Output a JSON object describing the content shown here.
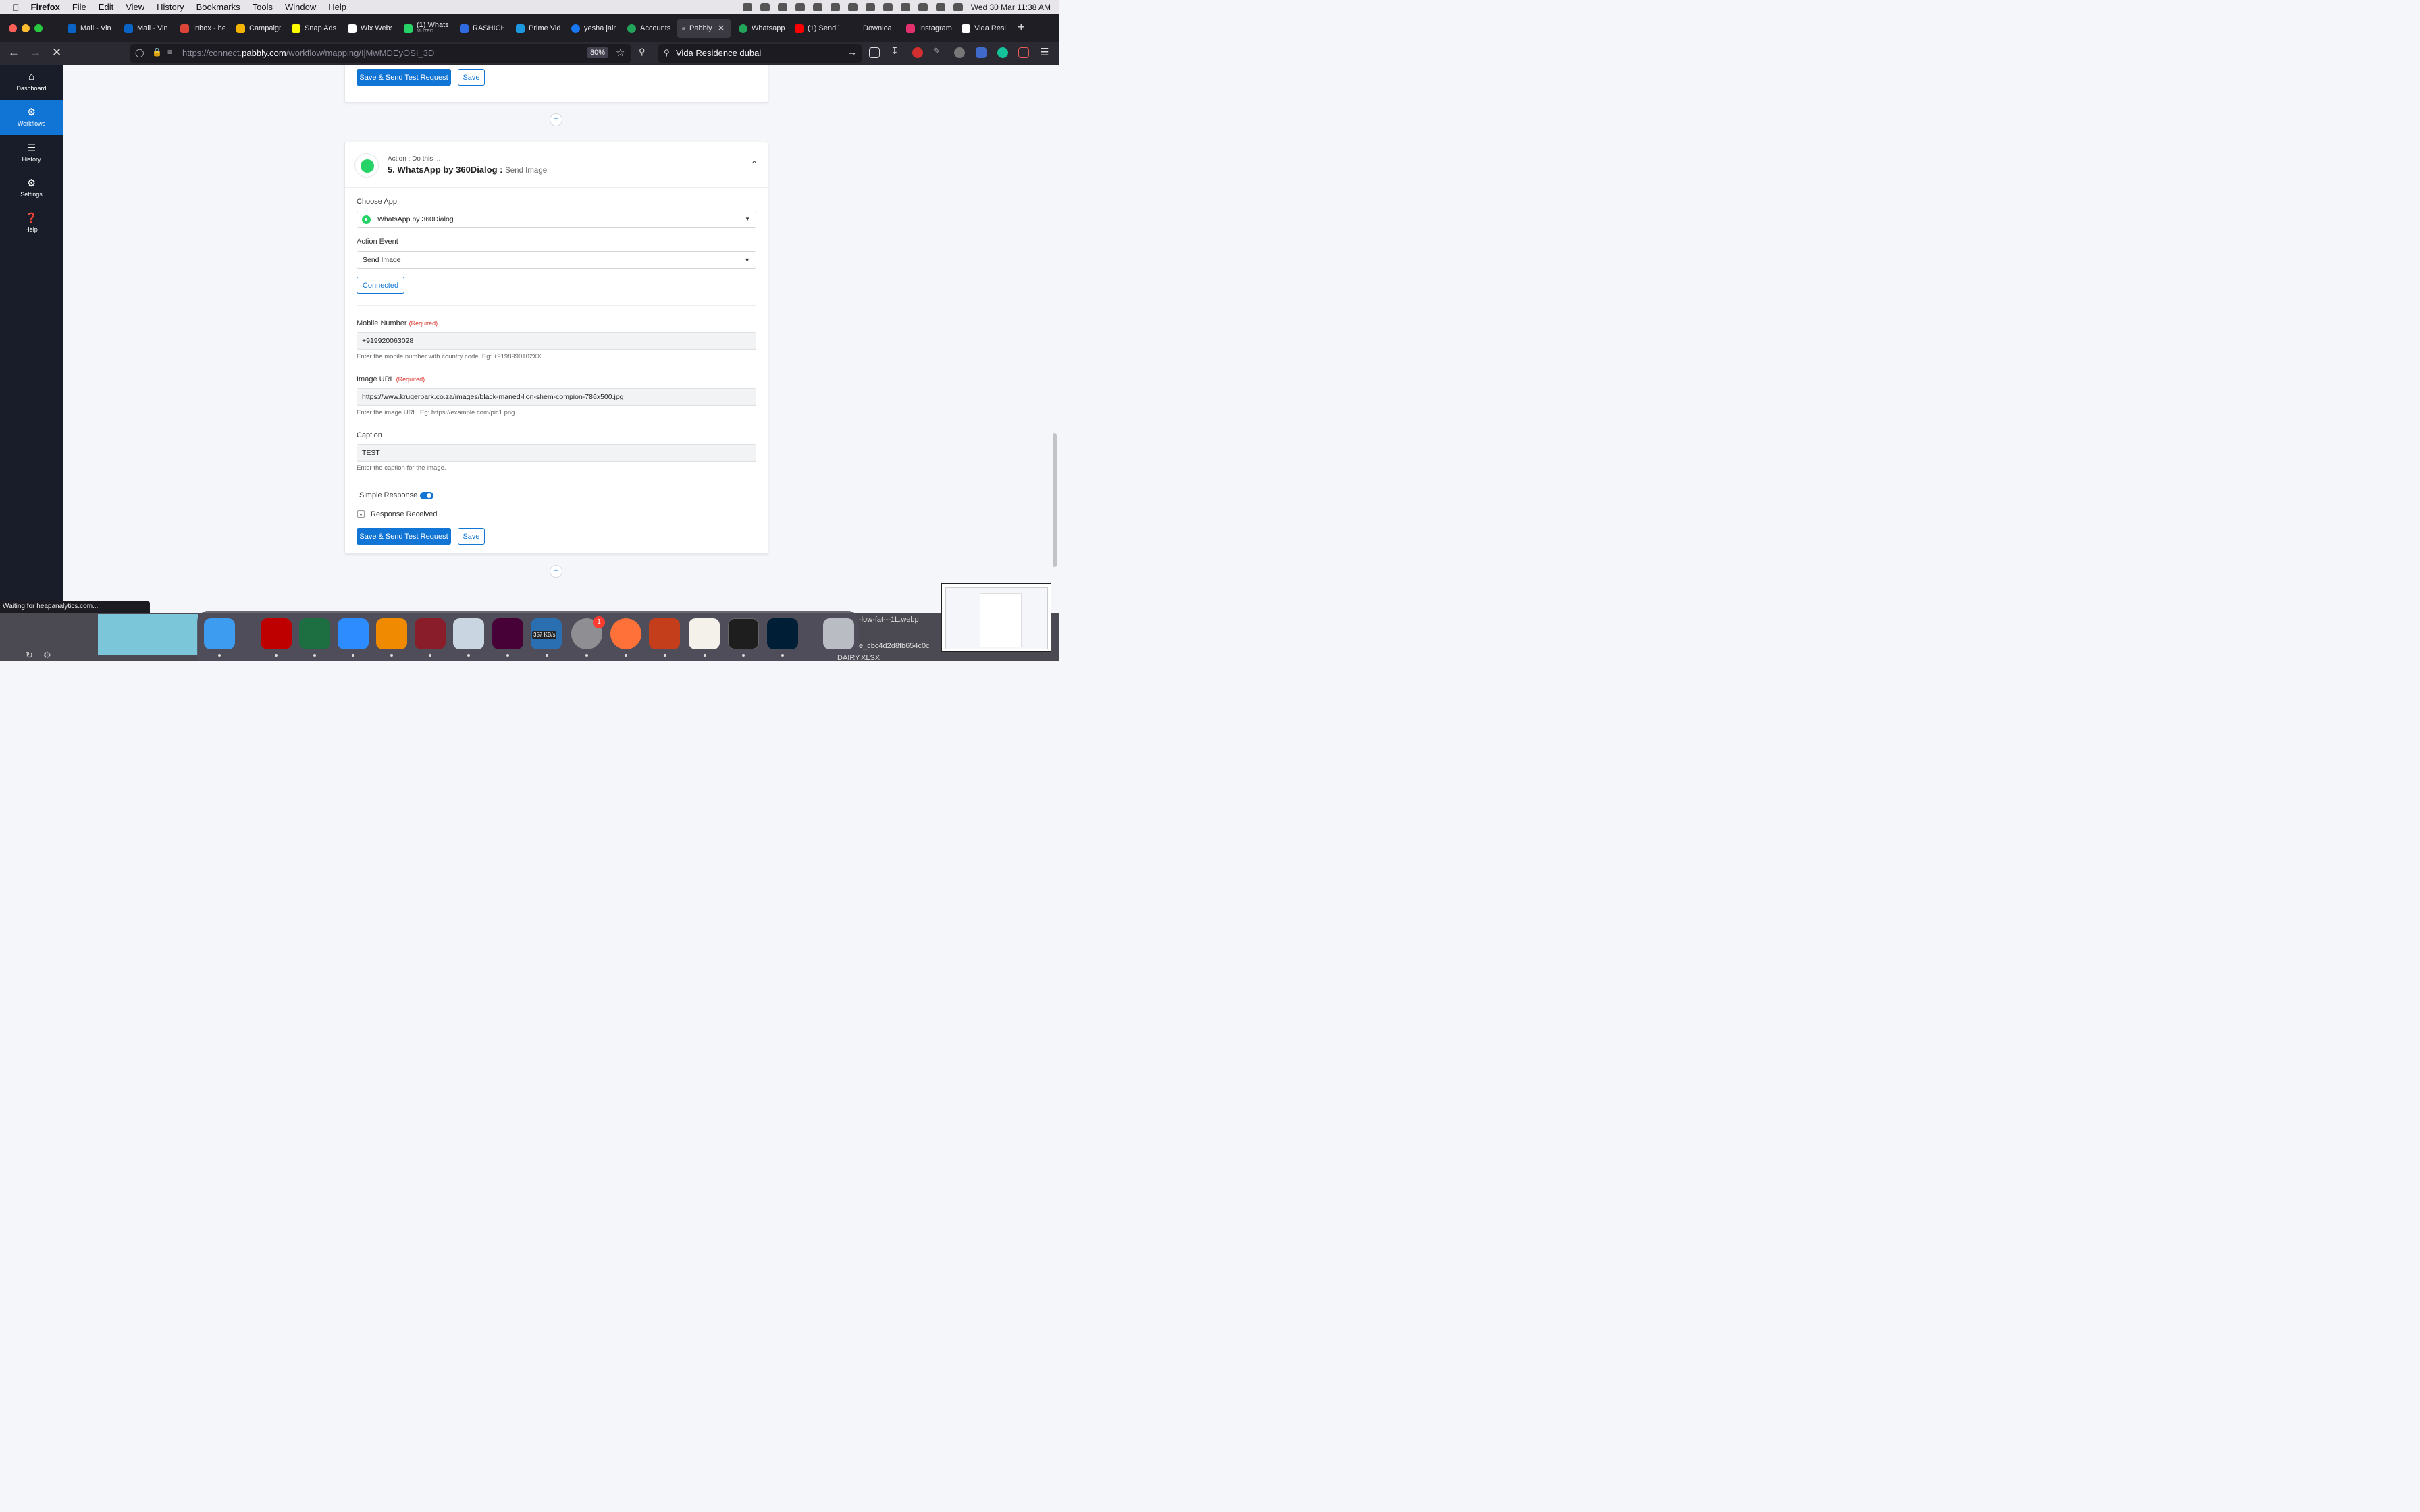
{
  "menubar": {
    "app": "Firefox",
    "items": [
      "File",
      "Edit",
      "View",
      "History",
      "Bookmarks",
      "Tools",
      "Window",
      "Help"
    ],
    "datetime": "Wed 30 Mar  11:38 AM"
  },
  "tabs": [
    {
      "label": "Mail - Vin",
      "color": "#0a64c8"
    },
    {
      "label": "Mail - Vin",
      "color": "#0a64c8"
    },
    {
      "label": "Inbox - he",
      "color": "#db4437"
    },
    {
      "label": "Campaign",
      "color": "#f4b400"
    },
    {
      "label": "Snap Ads",
      "color": "#fffc00"
    },
    {
      "label": "Wix Webs",
      "color": "#ffffff"
    },
    {
      "label": "(1) Whats",
      "muted": "MUTED",
      "color": "#25d366"
    },
    {
      "label": "RASHICH",
      "color": "#2f6ae0"
    },
    {
      "label": "Prime Vid",
      "color": "#1b98e0"
    },
    {
      "label": "yesha jain",
      "color": "#1877f2"
    },
    {
      "label": "Accounts",
      "color": "#22a55b"
    },
    {
      "label": "Pabbly",
      "color": "#888888",
      "active": true,
      "close": "✕"
    },
    {
      "label": "Whatsapp",
      "color": "#22a55b"
    },
    {
      "label": "(1) Send V",
      "color": "#ff0000"
    },
    {
      "label": "Downloa",
      "color": "transparent"
    },
    {
      "label": "Instagram",
      "color": "#e1306c"
    },
    {
      "label": "Vida Resi",
      "color": "#ffffff"
    }
  ],
  "navbar": {
    "url_prefix": "https://connect.",
    "url_domain": "pabbly.com",
    "url_path": "/workflow/mapping/IjMwMDEyOSI_3D",
    "zoom": "80%",
    "search_value": "Vida Residence dubai"
  },
  "sidebar": {
    "items": [
      {
        "label": "Dashboard",
        "icon": "home-icon"
      },
      {
        "label": "Workflows",
        "icon": "gear-workflow-icon",
        "active": true
      },
      {
        "label": "History",
        "icon": "list-icon"
      },
      {
        "label": "Settings",
        "icon": "gear-icon"
      },
      {
        "label": "Help",
        "icon": "question-icon"
      }
    ]
  },
  "prev_card": {
    "save_test_label": "Save & Send Test Request",
    "save_label": "Save"
  },
  "action_card": {
    "subtitle": "Action : Do this ...",
    "title_main": "5. WhatsApp by 360Dialog :",
    "title_event": "Send Image",
    "choose_app_label": "Choose App",
    "app_value": "WhatsApp by 360Dialog",
    "action_event_label": "Action Event",
    "event_value": "Send Image",
    "connected_label": "Connected",
    "required_text": "(Required)",
    "mobile_label": "Mobile Number",
    "mobile_value": "+919920063028",
    "mobile_help": "Enter the mobile number with country code. Eg: +9198990102XX.",
    "image_url_label": "Image URL",
    "image_url_value": "https://www.krugerpark.co.za/images/black-maned-lion-shem-compion-786x500.jpg",
    "image_url_help": "Enter the image URL. Eg: https://example.com/pic1.png",
    "caption_label": "Caption",
    "caption_value": "TEST",
    "caption_help": "Enter the caption for the image.",
    "simple_response_label": "Simple Response",
    "simple_response_on": true,
    "response_received_label": "Response Received",
    "save_test_label": "Save & Send Test Request",
    "save_label": "Save"
  },
  "status": "Waiting for heapanalytics.com...",
  "desktop_files": [
    "-low-fat---1L.webp",
    "e_cbc4d2d8fb654c0c",
    "DAIRY.XLSX"
  ],
  "dock": {
    "badge": "1",
    "network_speed": "357 KB/s",
    "apps": [
      {
        "name": "finder",
        "color": "#3d9bf0"
      },
      {
        "name": "filezilla",
        "color": "#bf0000"
      },
      {
        "name": "excel",
        "color": "#1d6f42"
      },
      {
        "name": "zoom",
        "color": "#2d8cff"
      },
      {
        "name": "vlc",
        "color": "#f08a00"
      },
      {
        "name": "quill",
        "color": "#8a1d2a"
      },
      {
        "name": "preview",
        "color": "#c9d6e2"
      },
      {
        "name": "dreamweaver",
        "color": "#470137"
      },
      {
        "name": "istat",
        "color": "#2a6fb1"
      },
      {
        "name": "system-prefs",
        "color": "#8e8e93"
      },
      {
        "name": "firefox",
        "color": "#ff7139"
      },
      {
        "name": "powerpoint",
        "color": "#c43e1c"
      },
      {
        "name": "textedit",
        "color": "#f3f1ea"
      },
      {
        "name": "terminal",
        "color": "#1e1e1e"
      },
      {
        "name": "photoshop",
        "color": "#001e36"
      },
      {
        "name": "trash",
        "color": "#b9bcc2"
      }
    ]
  }
}
